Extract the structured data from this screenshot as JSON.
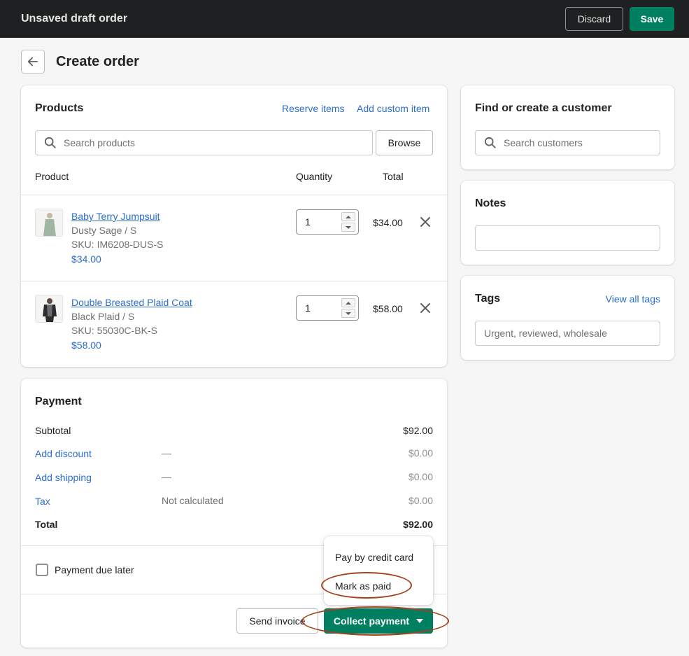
{
  "topbar": {
    "title": "Unsaved draft order",
    "discard_label": "Discard",
    "save_label": "Save"
  },
  "page": {
    "title": "Create order"
  },
  "products": {
    "title": "Products",
    "reserve_label": "Reserve items",
    "add_custom_label": "Add custom item",
    "search_placeholder": "Search products",
    "browse_label": "Browse",
    "columns": {
      "product": "Product",
      "quantity": "Quantity",
      "total": "Total"
    },
    "items": [
      {
        "name": "Baby Terry Jumpsuit",
        "variant": "Dusty Sage / S",
        "sku": "SKU: IM6208-DUS-S",
        "price": "$34.00",
        "quantity": "1",
        "total": "$34.00"
      },
      {
        "name": "Double Breasted Plaid Coat",
        "variant": "Black Plaid / S",
        "sku": "SKU: 55030C-BK-S",
        "price": "$58.00",
        "quantity": "1",
        "total": "$58.00"
      }
    ]
  },
  "payment": {
    "title": "Payment",
    "subtotal_label": "Subtotal",
    "subtotal_value": "$92.00",
    "discount_label": "Add discount",
    "discount_mid": "—",
    "discount_value": "$0.00",
    "shipping_label": "Add shipping",
    "shipping_mid": "—",
    "shipping_value": "$0.00",
    "tax_label": "Tax",
    "tax_mid": "Not calculated",
    "tax_value": "$0.00",
    "total_label": "Total",
    "total_value": "$92.00",
    "due_later_label": "Payment due later",
    "send_invoice_label": "Send invoice",
    "collect_label": "Collect payment",
    "menu": [
      "Pay by credit card",
      "Mark as paid"
    ]
  },
  "customer": {
    "title": "Find or create a customer",
    "search_placeholder": "Search customers"
  },
  "notes": {
    "title": "Notes",
    "value": ""
  },
  "tags": {
    "title": "Tags",
    "view_all_label": "View all tags",
    "placeholder": "Urgent, reviewed, wholesale"
  },
  "colors": {
    "primary": "#008060",
    "link": "#2c6ecb",
    "topbar": "#1f2021",
    "annotation": "#a0431c"
  },
  "icons": [
    "arrow-left-icon",
    "search-icon",
    "close-icon",
    "chevron-down-icon",
    "caret-up-icon",
    "caret-down-icon"
  ]
}
